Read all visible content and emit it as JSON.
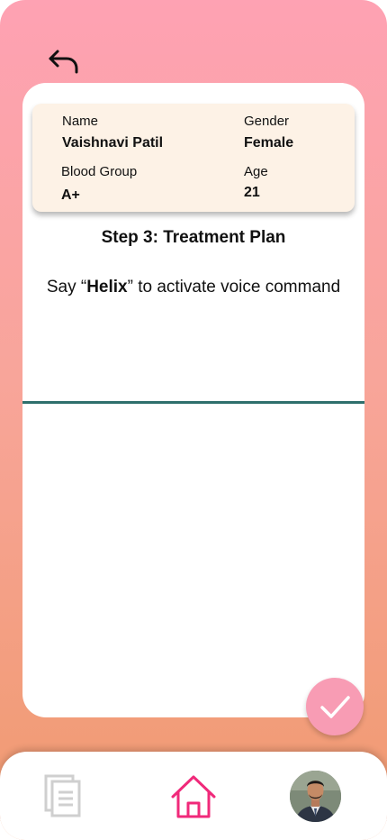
{
  "nav": {
    "back_icon": "undo-arrow-icon"
  },
  "patient": {
    "name_label": "Name",
    "name_value": "Vaishnavi Patil",
    "gender_label": "Gender",
    "gender_value": "Female",
    "blood_label": "Blood Group",
    "blood_value": "A+",
    "age_label": "Age",
    "age_value": "21"
  },
  "step": {
    "title": "Step 3: Treatment Plan"
  },
  "voice": {
    "prefix": "Say “",
    "keyword": "Helix",
    "suffix": "” to activate voice command"
  },
  "actions": {
    "confirm_icon": "check-icon"
  },
  "tabs": [
    {
      "icon": "documents-icon"
    },
    {
      "icon": "home-icon"
    },
    {
      "icon": "profile-avatar"
    }
  ],
  "colors": {
    "gradient_top": "#fea2b3",
    "gradient_bottom": "#f09a6f",
    "accent_pink": "#f0297a",
    "confirm_button": "#f89cb4",
    "divider": "#2e6f6c",
    "patient_card_bg": "#fdf2e6"
  }
}
